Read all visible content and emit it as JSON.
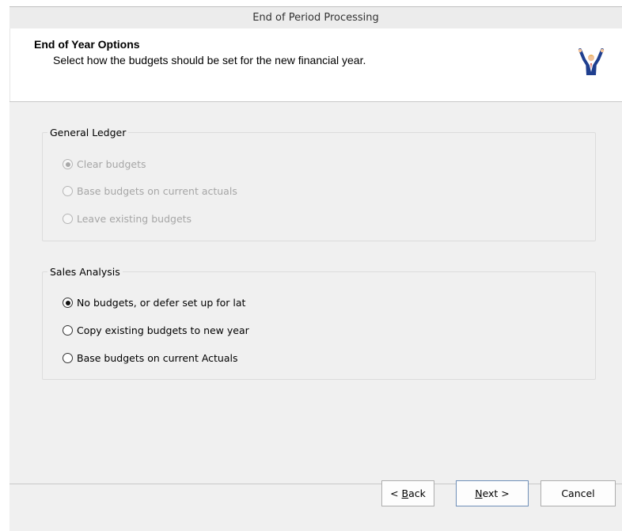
{
  "window": {
    "title": "End of Period Processing"
  },
  "header": {
    "title": "End of Year Options",
    "subtitle": "Select how the budgets should be set for the new financial year.",
    "icon": "wizard-figure-icon"
  },
  "general_ledger": {
    "legend": "General Ledger",
    "enabled": false,
    "options": [
      {
        "label": "Clear budgets",
        "checked": true
      },
      {
        "label": "Base budgets on current actuals",
        "checked": false
      },
      {
        "label": "Leave existing budgets",
        "checked": false
      }
    ]
  },
  "sales_analysis": {
    "legend": "Sales Analysis",
    "enabled": true,
    "options": [
      {
        "label": "No budgets, or defer set up for lat",
        "checked": true
      },
      {
        "label": "Copy existing budgets to new year",
        "checked": false
      },
      {
        "label": "Base budgets on current Actuals",
        "checked": false
      }
    ]
  },
  "buttons": {
    "back_prefix": "< ",
    "back_mnemonic": "B",
    "back_rest": "ack",
    "next_mnemonic": "N",
    "next_rest": "ext >",
    "cancel": "Cancel"
  }
}
